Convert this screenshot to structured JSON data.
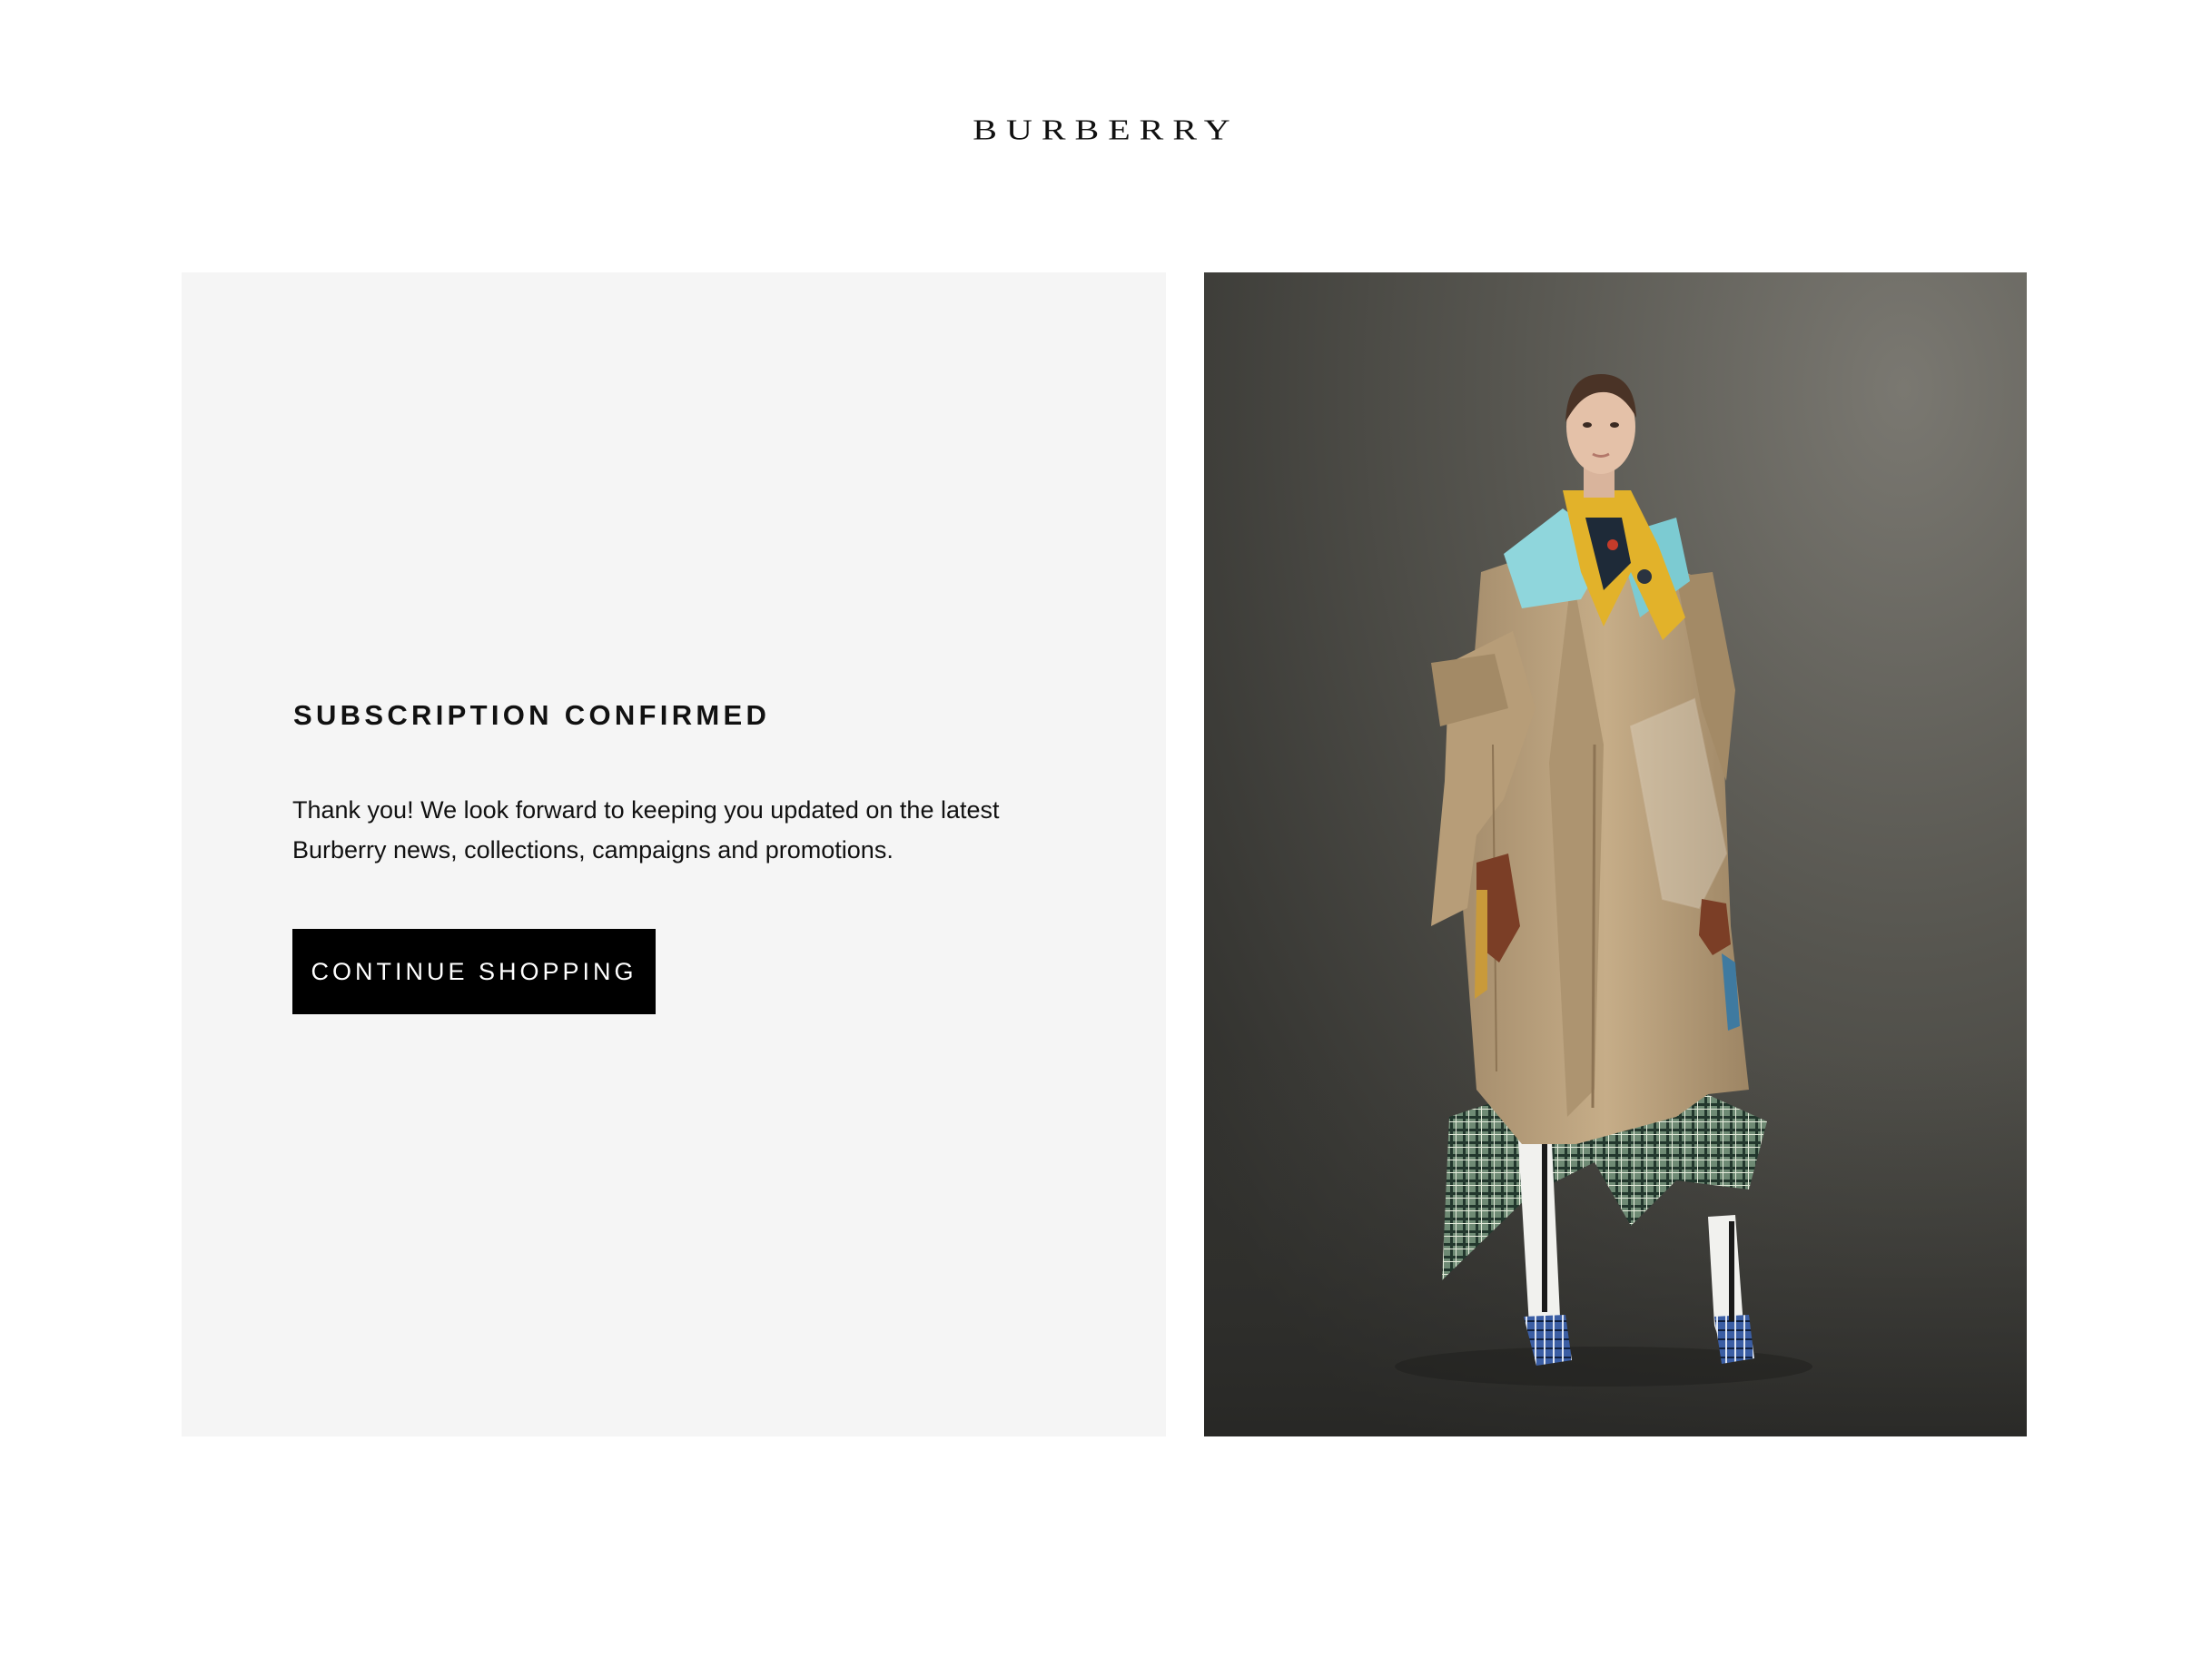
{
  "brand": {
    "logo_text": "BURBERRY"
  },
  "confirmation": {
    "heading": "SUBSCRIPTION CONFIRMED",
    "message": "Thank you! We look forward to keeping you updated on the latest Burberry news, collections, campaigns and promotions.",
    "button_label": "CONTINUE SHOPPING"
  },
  "colors": {
    "panel_background": "#f5f5f5",
    "button_background": "#000000",
    "button_text": "#ffffff",
    "photo_background": "#4a4944"
  }
}
